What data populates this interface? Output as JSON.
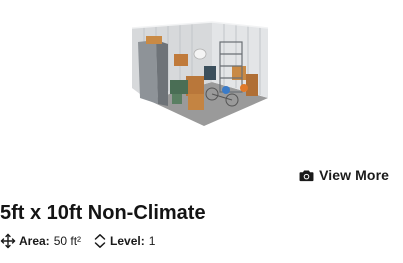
{
  "unit": {
    "view_more_label": "View More",
    "title": "5ft x 10ft Non-Climate",
    "area_label": "Area:",
    "area_value": "50 ft²",
    "level_label": "Level:",
    "level_value": "1"
  },
  "icons": {
    "view_more": "camera-icon",
    "area": "move-arrows-icon",
    "level": "chevron-up-down-icon"
  }
}
